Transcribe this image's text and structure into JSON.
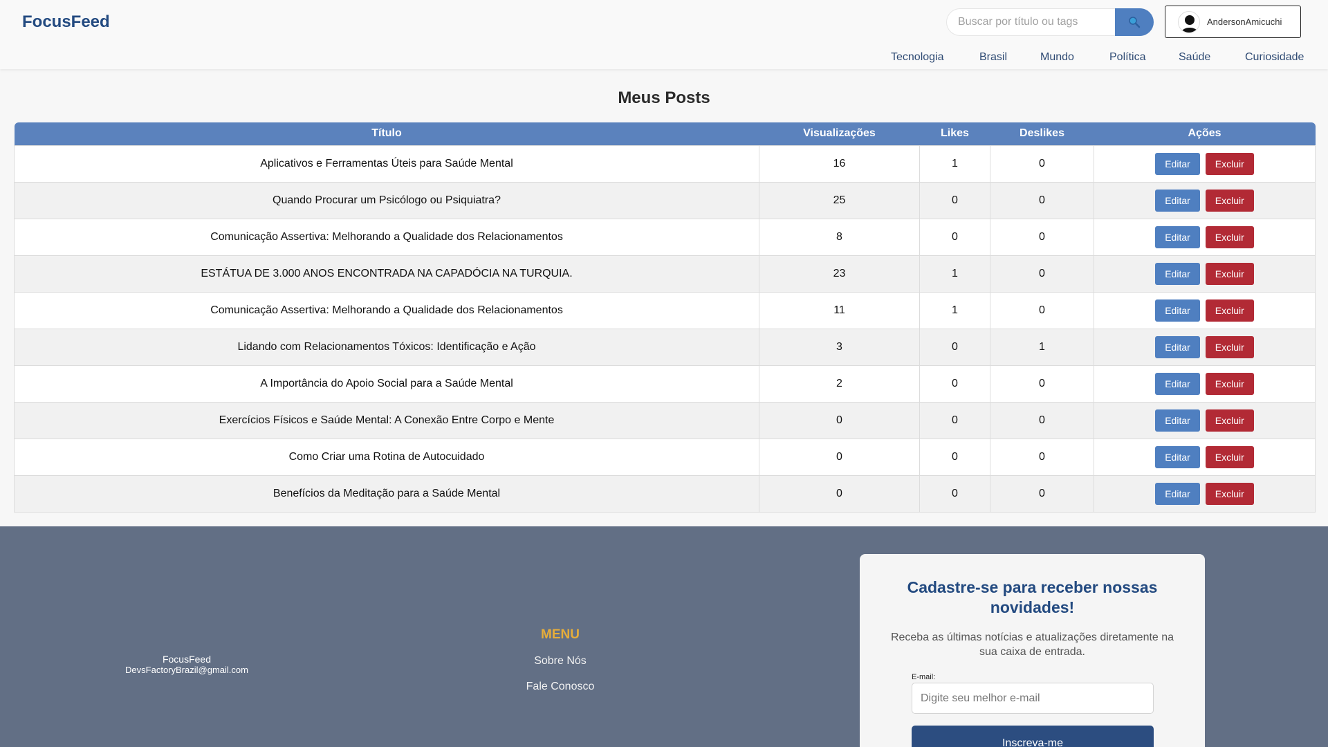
{
  "header": {
    "brand": "FocusFeed",
    "search_placeholder": "Buscar por título ou tags",
    "search_icon": "search-icon",
    "user_name": "AndersonAmicuchi"
  },
  "nav": [
    "Tecnologia",
    "Brasil",
    "Mundo",
    "Política",
    "Saúde",
    "Curiosidade"
  ],
  "main": {
    "title": "Meus Posts",
    "columns": [
      "Título",
      "Visualizações",
      "Likes",
      "Deslikes",
      "Ações"
    ],
    "edit_label": "Editar",
    "delete_label": "Excluir",
    "rows": [
      {
        "title": "Aplicativos e Ferramentas Úteis para Saúde Mental",
        "views": "16",
        "likes": "1",
        "dislikes": "0"
      },
      {
        "title": "Quando Procurar um Psicólogo ou Psiquiatra?",
        "views": "25",
        "likes": "0",
        "dislikes": "0"
      },
      {
        "title": "Comunicação Assertiva: Melhorando a Qualidade dos Relacionamentos",
        "views": "8",
        "likes": "0",
        "dislikes": "0"
      },
      {
        "title": "ESTÁTUA DE 3.000 ANOS ENCONTRADA NA CAPADÓCIA NA TURQUIA.",
        "views": "23",
        "likes": "1",
        "dislikes": "0"
      },
      {
        "title": "Comunicação Assertiva: Melhorando a Qualidade dos Relacionamentos",
        "views": "11",
        "likes": "1",
        "dislikes": "0"
      },
      {
        "title": "Lidando com Relacionamentos Tóxicos: Identificação e Ação",
        "views": "3",
        "likes": "0",
        "dislikes": "1"
      },
      {
        "title": "A Importância do Apoio Social para a Saúde Mental",
        "views": "2",
        "likes": "0",
        "dislikes": "0"
      },
      {
        "title": "Exercícios Físicos e Saúde Mental: A Conexão Entre Corpo e Mente",
        "views": "0",
        "likes": "0",
        "dislikes": "0"
      },
      {
        "title": "Como Criar uma Rotina de Autocuidado",
        "views": "0",
        "likes": "0",
        "dislikes": "0"
      },
      {
        "title": "Benefícios da Meditação para a Saúde Mental",
        "views": "0",
        "likes": "0",
        "dislikes": "0"
      }
    ]
  },
  "footer": {
    "brand": "FocusFeed",
    "email": "DevsFactoryBrazil@gmail.com",
    "menu_title": "MENU",
    "menu_items": [
      "Sobre Nós",
      "Fale Conosco"
    ],
    "newsletter": {
      "title": "Cadastre-se para receber nossas novidades!",
      "subtitle": "Receba as últimas notícias e atualizações diretamente na sua caixa de entrada.",
      "email_label": "E-mail:",
      "email_placeholder": "Digite seu melhor e-mail",
      "button_label": "Inscreva-me"
    }
  },
  "colors": {
    "brand": "#234a80",
    "accent": "#4f7fc0",
    "table_header": "#5b82bd",
    "danger": "#b22a35",
    "footer_bg": "#626f85",
    "menu_title": "#e6ad3a"
  }
}
